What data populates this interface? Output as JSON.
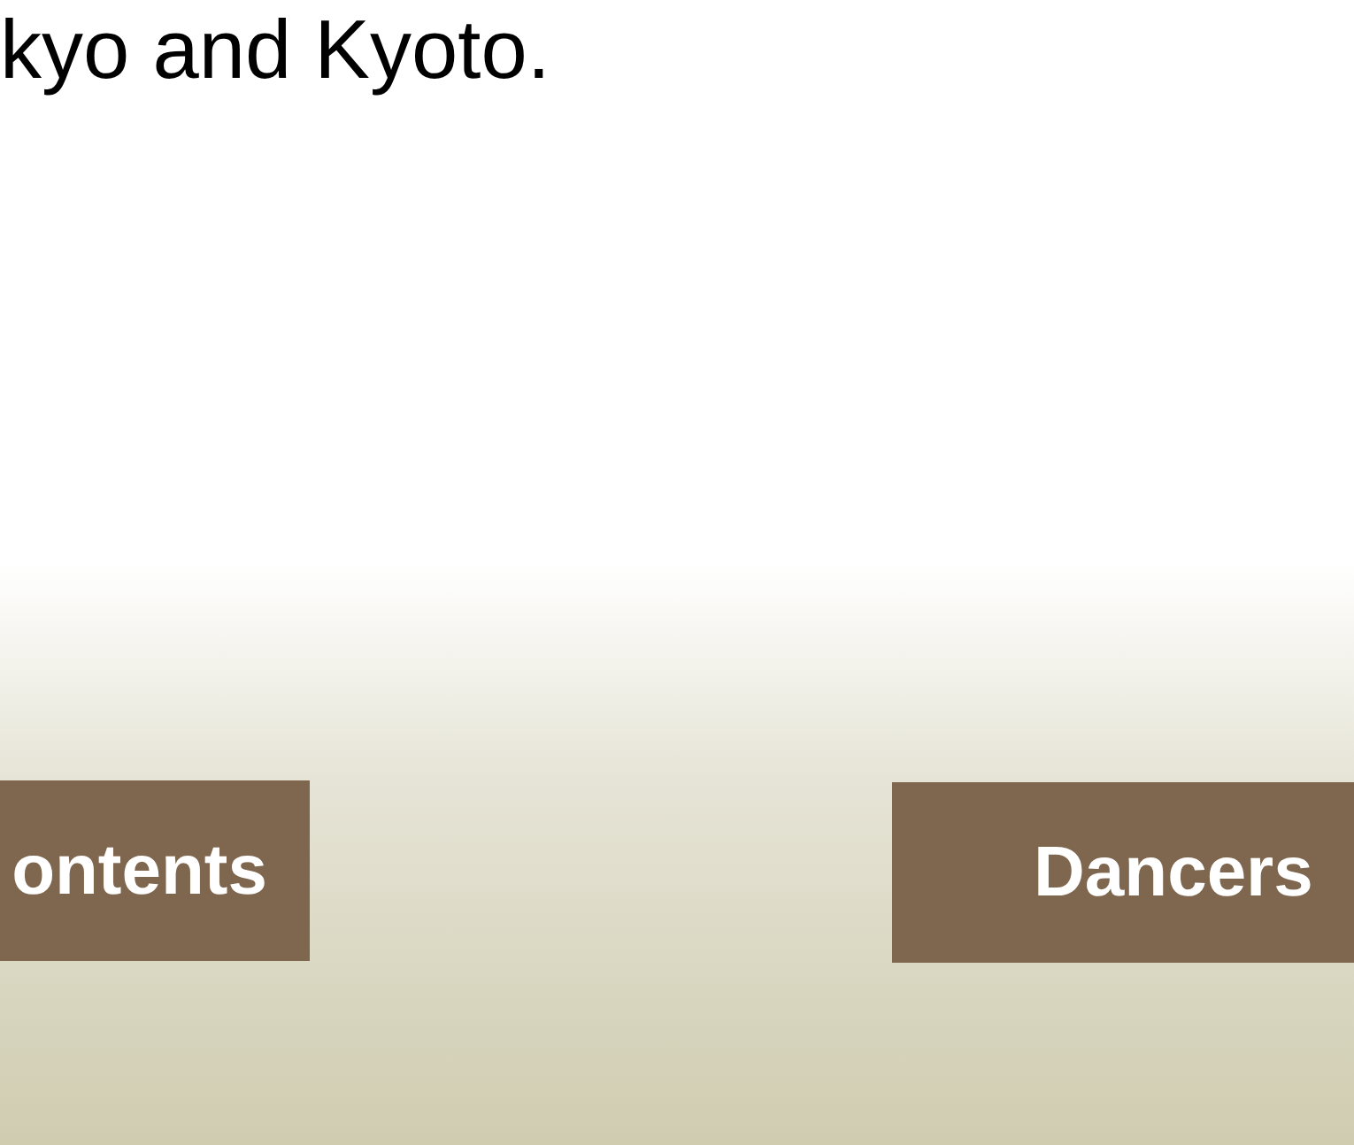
{
  "intro_text": "kyo and Kyoto.",
  "nav_buttons": [
    {
      "label": "ontents"
    },
    {
      "label": "Dancers"
    }
  ]
}
